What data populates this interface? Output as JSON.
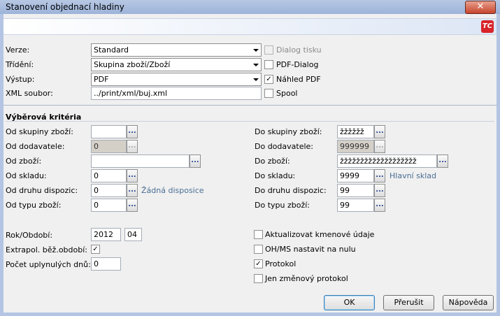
{
  "window": {
    "title": "Stanovení objednací hladiny",
    "close": "✕",
    "logo": "TC"
  },
  "settings": {
    "verze_label": "Verze:",
    "verze_value": "Standard",
    "trideni_label": "Třídění:",
    "trideni_value": "Skupina zboží/Zboží",
    "vystup_label": "Výstup:",
    "vystup_value": "PDF",
    "xml_label": "XML soubor:",
    "xml_value": "../print/xml/buj.xml",
    "dialog_tisku": "Dialog tisku",
    "pdf_dialog": "PDF-Dialog",
    "nahled_pdf": "Náhled PDF",
    "spool": "Spool"
  },
  "criteria": {
    "title": "Výběrová kritéria",
    "od_skupiny_label": "Od skupiny zboží:",
    "od_skupiny_value": "",
    "od_dodavatele_label": "Od dodavatele:",
    "od_dodavatele_value": "0",
    "od_zbozi_label": "Od zboží:",
    "od_zbozi_value": "",
    "od_skladu_label": "Od skladu:",
    "od_skladu_value": "0",
    "od_druhu_label": "Od druhu dispozic:",
    "od_druhu_value": "0",
    "od_druhu_info": "Žádná disposice",
    "od_typu_label": "Od typu zboží:",
    "od_typu_value": "0",
    "do_skupiny_label": "Do skupiny zboží:",
    "do_skupiny_value": "žžžžžž",
    "do_dodavatele_label": "Do dodavatele:",
    "do_dodavatele_value": "999999",
    "do_zbozi_label": "Do zboží:",
    "do_zbozi_value": "žžžžžžžžžžžžžžžžžžž",
    "do_skladu_label": "Do skladu:",
    "do_skladu_value": "9999",
    "do_skladu_info": "Hlavní sklad",
    "do_druhu_label": "Do druhu dispozic:",
    "do_druhu_value": "99",
    "do_typu_label": "Do typu zboží:",
    "do_typu_value": "99"
  },
  "period": {
    "rok_label": "Rok/Období:",
    "rok_value": "2012",
    "obdobi_value": "04",
    "extrapol_label": "Extrapol. běž.období:",
    "pocet_label": "Počet uplynulých dnů:",
    "pocet_value": "0"
  },
  "options": {
    "aktualizovat": "Aktualizovat kmenové údaje",
    "ohms": "OH/MS nastavit na nulu",
    "protokol": "Protokol",
    "zmenovy": "Jen změnový protokol"
  },
  "buttons": {
    "ok": "OK",
    "prerusit": "Přerušit",
    "napoveda": "Nápověda",
    "browse": "..."
  },
  "check_mark": "✓"
}
